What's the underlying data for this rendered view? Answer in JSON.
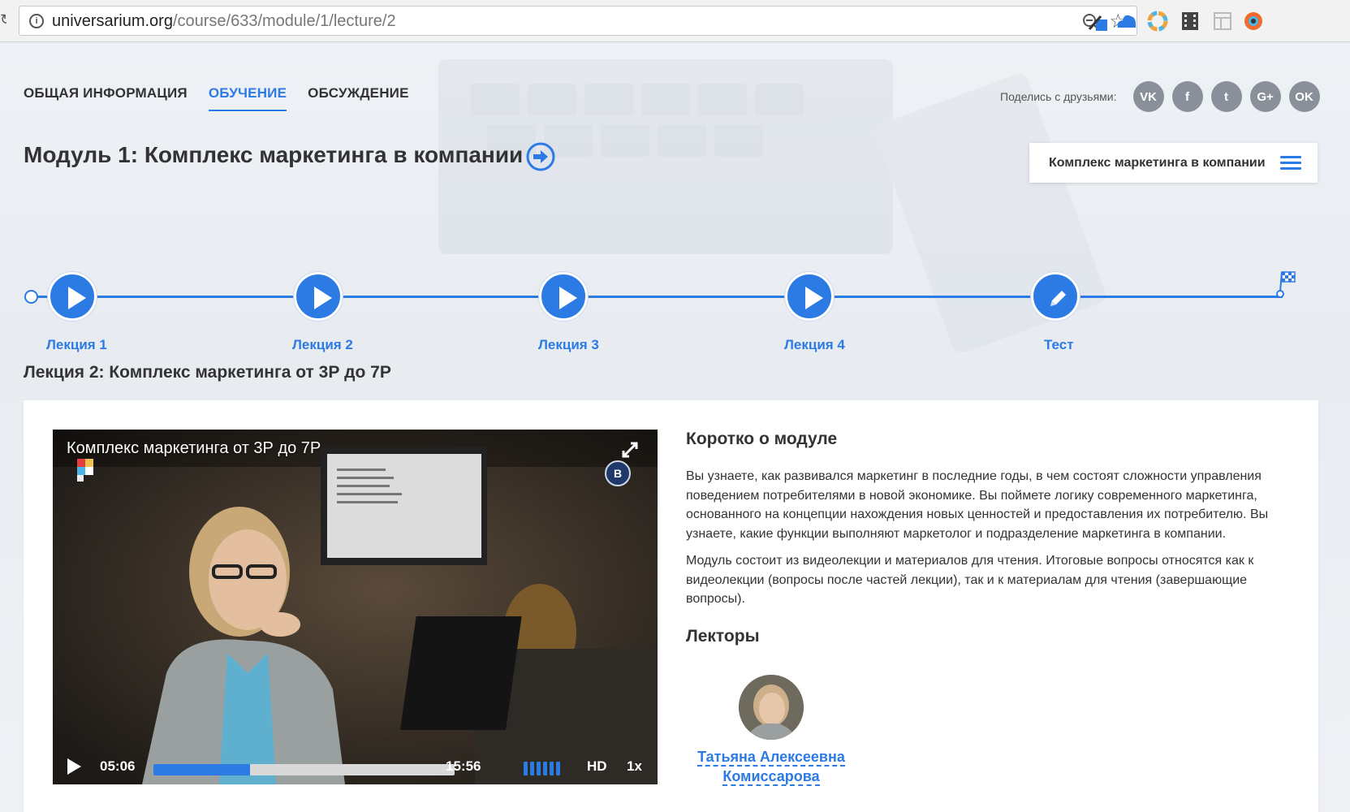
{
  "browser": {
    "url_domain": "universarium.org",
    "url_path": "/course/633/module/1/lecture/2"
  },
  "nav": {
    "tabs": [
      {
        "label": "ОБЩАЯ ИНФОРМАЦИЯ",
        "active": false
      },
      {
        "label": "ОБУЧЕНИЕ",
        "active": true
      },
      {
        "label": "ОБСУЖДЕНИЕ",
        "active": false
      }
    ]
  },
  "share": {
    "label": "Поделись с друзьями:",
    "networks": [
      {
        "name": "vk-icon",
        "glyph": "VK"
      },
      {
        "name": "facebook-icon",
        "glyph": "f"
      },
      {
        "name": "twitter-icon",
        "glyph": "t"
      },
      {
        "name": "google-plus-icon",
        "glyph": "G+"
      },
      {
        "name": "odnoklassniki-icon",
        "glyph": "OK"
      }
    ]
  },
  "module": {
    "title": "Модуль 1: Комплекс маркетинга в компании",
    "menu_label": "Комплекс маркетинга в компании"
  },
  "timeline": {
    "steps": [
      {
        "label": "Лекция 1",
        "type": "video"
      },
      {
        "label": "Лекция 2",
        "type": "video"
      },
      {
        "label": "Лекция 3",
        "type": "video"
      },
      {
        "label": "Лекция 4",
        "type": "video"
      },
      {
        "label": "Тест",
        "type": "test"
      }
    ]
  },
  "lecture": {
    "title": "Лекция 2: Комплекс маркетинга от 3Р до 7Р"
  },
  "video": {
    "title": "Комплекс маркетинга от 3Р до 7Р",
    "current_time": "05:06",
    "duration": "15:56",
    "progress_fraction": 0.32,
    "quality": "HD",
    "speed": "1x",
    "volume_bars": 6
  },
  "about": {
    "heading": "Коротко о модуле",
    "paragraph_1": "Вы узнаете, как развивался маркетинг в последние годы, в чем состоят сложности управления поведением потребителями в новой экономике. Вы поймете логику современного маркетинга, основанного на концепции нахождения новых ценностей и предоставления их потребителю. Вы узнаете, какие функции выполняют маркетолог и подразделение маркетинга в компании.",
    "paragraph_2": "Модуль состоит из видеолекции и материалов для чтения. Итоговые вопросы относятся как к видеолекции (вопросы после частей лекции), так и к материалам для чтения (завершающие вопросы).",
    "lecturers_heading": "Лекторы"
  },
  "lecturer": {
    "first_line": "Татьяна Алексеевна",
    "second_line": "Комиссарова"
  },
  "colors": {
    "accent": "#2c7be5",
    "social": "#8a9099"
  }
}
